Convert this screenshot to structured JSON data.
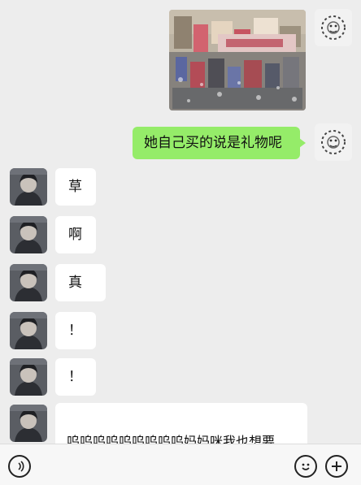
{
  "messages": {
    "sent_text": "她自己买的说是礼物呢",
    "received_long": "呜呜呜呜呜呜呜呜呜妈妈咪我也想要\n[表情]",
    "received_singles": [
      "草",
      "啊",
      "真",
      "！",
      "！"
    ]
  },
  "icons": {
    "voice": "voice-icon",
    "emoji": "emoji-icon",
    "plus": "plus-icon"
  },
  "colors": {
    "background": "#ededed",
    "sent_bubble": "#95ec69",
    "received_bubble": "#ffffff"
  }
}
